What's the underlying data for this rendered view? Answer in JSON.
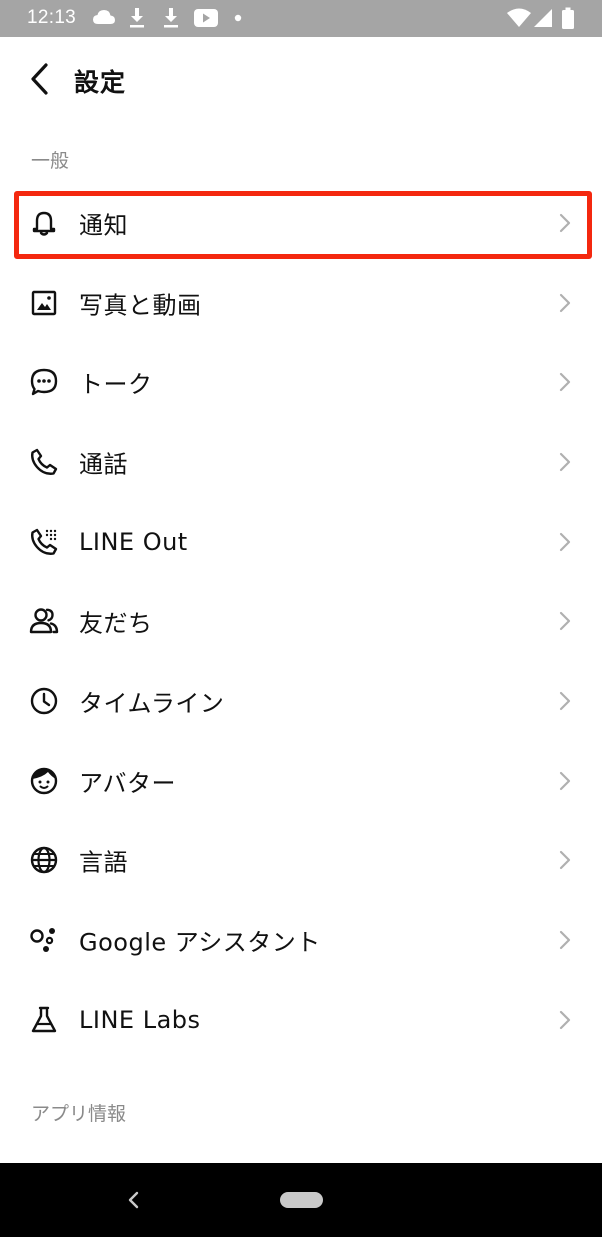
{
  "status_bar": {
    "time": "12:13",
    "left_icons": [
      "cloud-icon",
      "download-icon",
      "download-icon",
      "youtube-icon",
      "dot-icon"
    ],
    "right_icons": [
      "wifi-icon",
      "signal-icon",
      "battery-icon"
    ]
  },
  "header": {
    "title": "設定",
    "back_icon": "chevron-left-icon"
  },
  "sections": {
    "general": "一般",
    "app_info": "アプリ情報"
  },
  "menu_items": [
    {
      "label": "通知",
      "icon": "bell-icon"
    },
    {
      "label": "写真と動画",
      "icon": "photo-icon"
    },
    {
      "label": "トーク",
      "icon": "chat-bubble-icon"
    },
    {
      "label": "通話",
      "icon": "phone-icon"
    },
    {
      "label": "LINE Out",
      "icon": "phone-dialpad-icon"
    },
    {
      "label": "友だち",
      "icon": "friends-icon"
    },
    {
      "label": "タイムライン",
      "icon": "clock-icon"
    },
    {
      "label": "アバター",
      "icon": "avatar-icon"
    },
    {
      "label": "言語",
      "icon": "globe-icon"
    },
    {
      "label": "Google アシスタント",
      "icon": "google-assistant-icon"
    },
    {
      "label": "LINE Labs",
      "icon": "flask-icon"
    }
  ],
  "highlighted_item": "通知",
  "colors": {
    "status_bar_bg": "#a5a5a5",
    "highlight_border": "#f4280f",
    "section_header": "#8a8a8a",
    "chevron": "#b0b0b0",
    "nav_bar_bg": "#000000"
  }
}
